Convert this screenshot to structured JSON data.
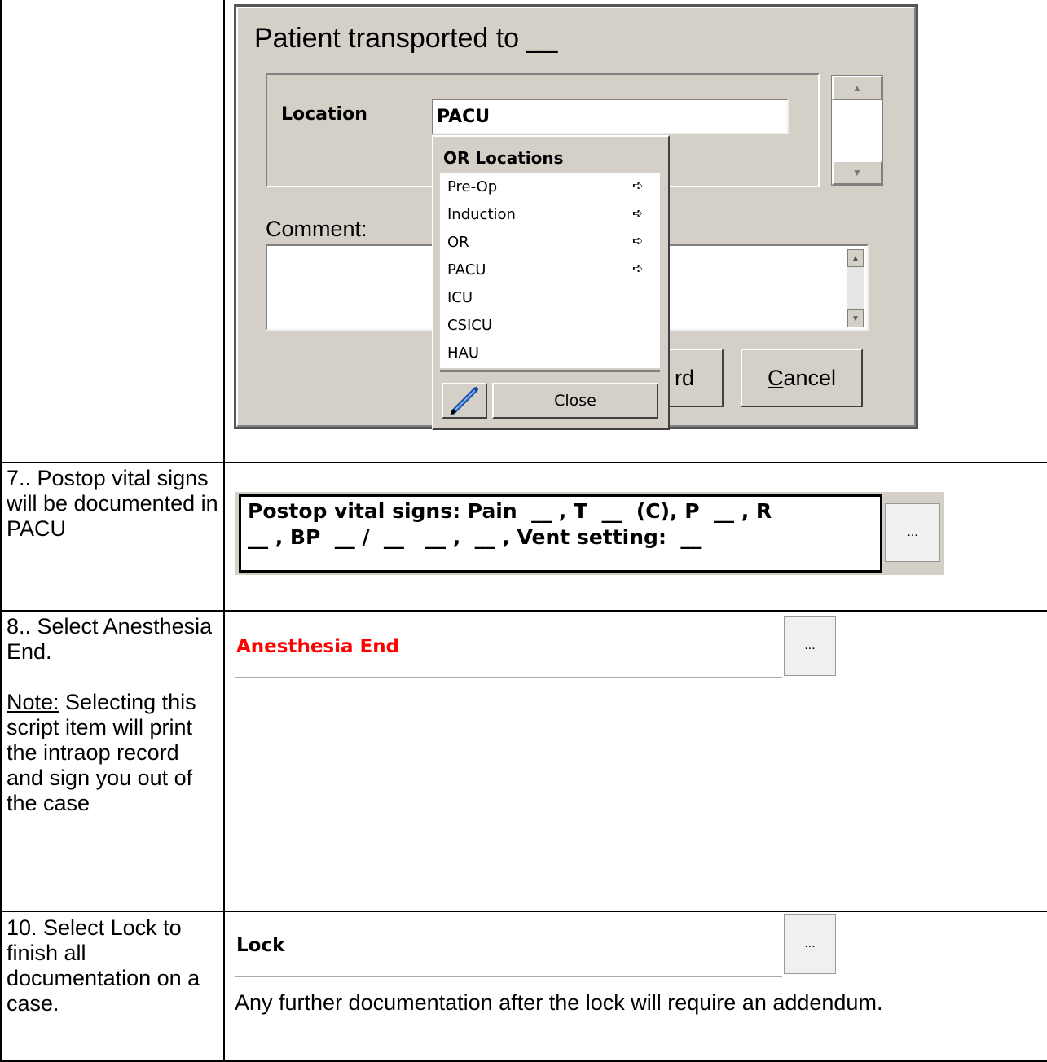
{
  "rows": [
    {
      "step": ""
    },
    {
      "step": "7.. Postop vital signs will be documented in PACU"
    },
    {
      "step": "8.. Select Anesthesia End.",
      "note_label": "Note:",
      "note_text": " Selecting this script item will print the intraop record and sign you out of the case"
    },
    {
      "step": "10. Select Lock to finish all documentation on a case."
    }
  ],
  "dialog": {
    "title": "Patient transported to  __",
    "location_label": "Location",
    "location_value": "PACU",
    "comment_label": "Comment:",
    "record_button_visible": "rd",
    "cancel_button_prefix": "C",
    "cancel_button_rest": "ancel"
  },
  "menu": {
    "title": "OR Locations",
    "items": [
      {
        "label": "Pre-Op",
        "arrow": "➪"
      },
      {
        "label": "Induction",
        "arrow": "➪"
      },
      {
        "label": "OR",
        "arrow": "➪"
      },
      {
        "label": "PACU",
        "arrow": "➪"
      },
      {
        "label": "ICU",
        "arrow": ""
      },
      {
        "label": "CSICU",
        "arrow": ""
      },
      {
        "label": "HAU",
        "arrow": ""
      }
    ],
    "close_label": "Close"
  },
  "vitals": {
    "line1": "Postop vital signs: Pain  __ , T  __  (C), P  __ , R",
    "line2": "__ , BP  __ /  __   __ ,  __ , Vent setting:  __",
    "button_label": "..."
  },
  "anesthesia_end": {
    "label": "Anesthesia End",
    "button_label": "...",
    "color": "#ff0000"
  },
  "lock": {
    "label": "Lock",
    "button_label": "...",
    "note": "Any further documentation after the lock will require an addendum."
  },
  "colors": {
    "dialog_bg": "#d4d0c8",
    "grid": "#000000",
    "alert": "#ff0000"
  }
}
